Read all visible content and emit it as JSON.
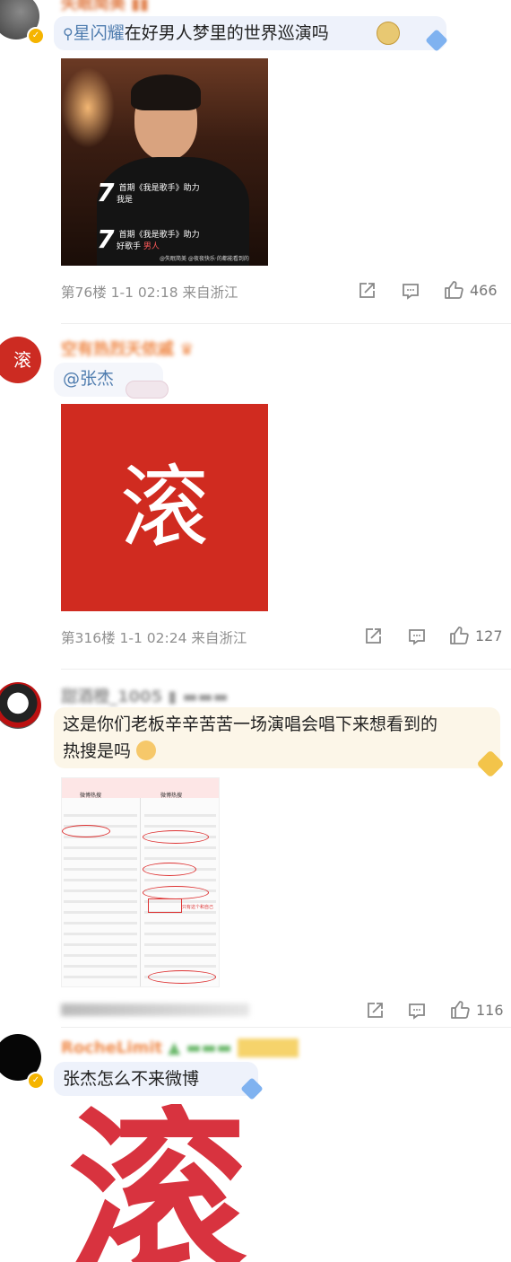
{
  "comments": [
    {
      "avatar_text": "",
      "text_prefix": "",
      "search_link": "星闪耀",
      "text": "在好男人梦里的世界巡演吗",
      "image_caption": {
        "line1_num": "7",
        "line1_text": "首期《我是歌手》助力",
        "line1_sub": "我是",
        "line2_num": "7",
        "line2_text": "首期《我是歌手》助力",
        "line2_sub": "好歌手",
        "line2_sub_red": "男人",
        "watermark": "@失眠简美 @夜夜快乐·的都能看到的"
      },
      "floor": "第76楼",
      "time": "1-1 02:18",
      "location": "来自浙江",
      "likes": "466"
    },
    {
      "avatar_text": "滚",
      "mention": "@张杰",
      "image_text": "滚",
      "floor": "第316楼",
      "time": "1-1 02:24",
      "location": "来自浙江",
      "likes": "127"
    },
    {
      "username": "甜酒橙_1005",
      "text_line1": "这是你们老板辛辛苦苦一场演唱会唱下来想看到的",
      "text_line2": "热搜是吗",
      "likes": "116",
      "screenshot": {
        "header_left": "微博热搜",
        "header_right": "微博热搜",
        "note": "只有这个和自己"
      }
    },
    {
      "username": "RocheLimit",
      "text": "张杰怎么不来微博",
      "image_text": "滚"
    }
  ],
  "colors": {
    "accent_blue": "#507daf",
    "red_block": "#d02b20",
    "bubble_blue": "#eef2fb",
    "bubble_cream": "#fcf6e8",
    "meta_gray": "#8f8f8f"
  },
  "icons": [
    "share-icon",
    "comment-icon",
    "like-icon",
    "search-icon",
    "verified-badge-icon"
  ]
}
